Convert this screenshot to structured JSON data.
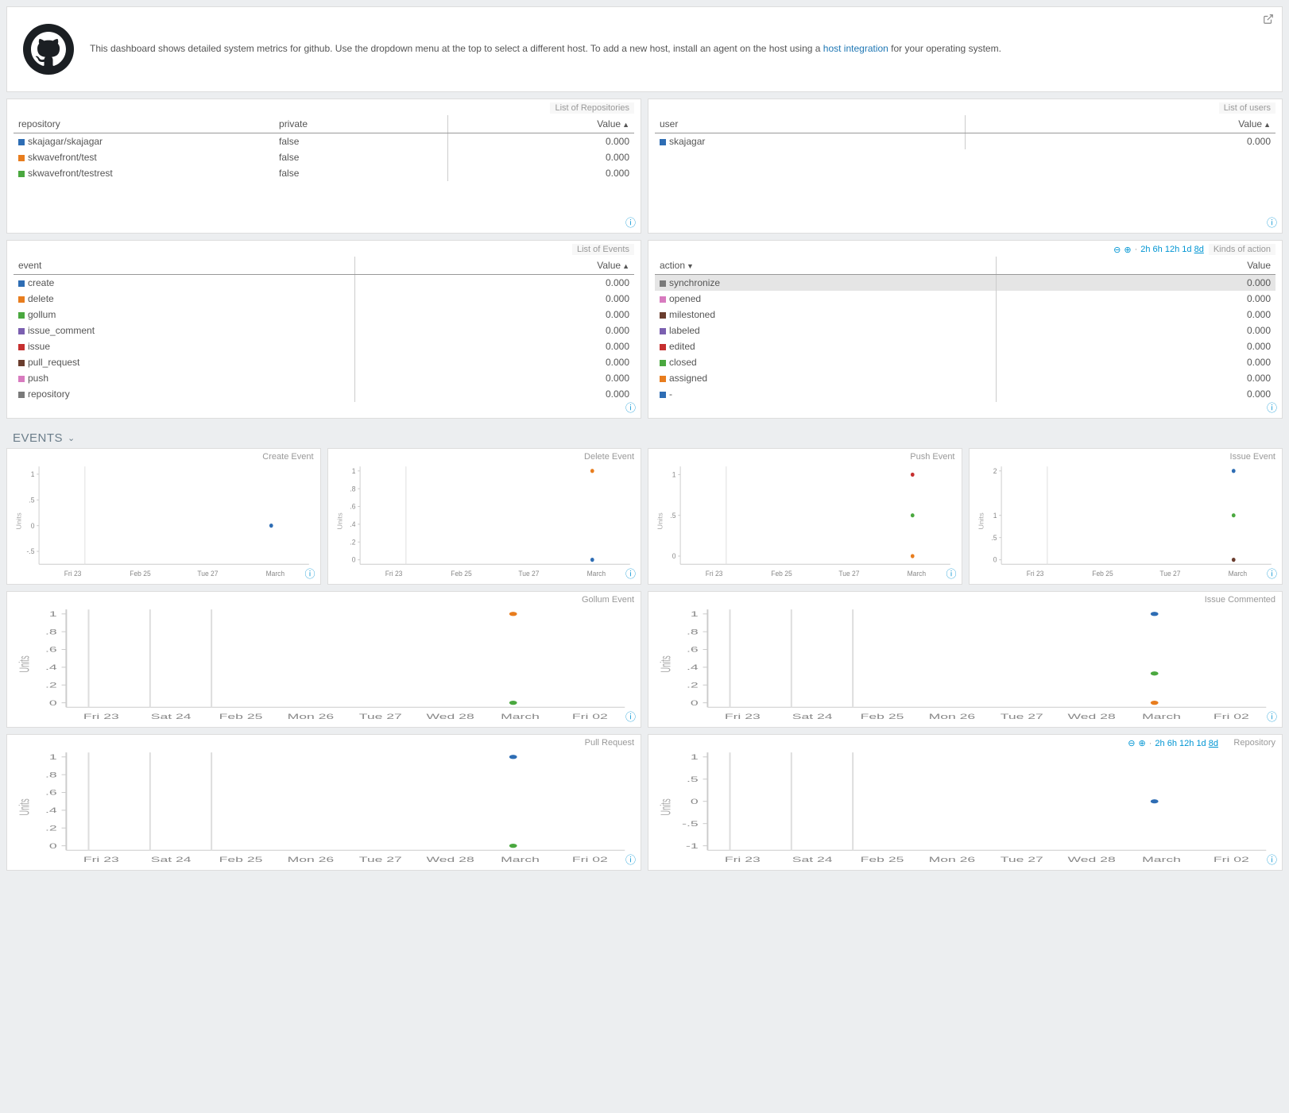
{
  "header": {
    "text_before": "This dashboard shows detailed system metrics for github. Use the dropdown menu at the top to select a different host. To add a new host, install an agent on the host using a ",
    "link_text": "host integration",
    "text_after": " for your operating system."
  },
  "time_links": [
    "2h",
    "6h",
    "12h",
    "1d",
    "8d"
  ],
  "panels": {
    "repos": {
      "title": "List of Repositories",
      "cols": [
        "repository",
        "private",
        "Value"
      ],
      "rows": [
        {
          "color": "#2e6db4",
          "name": "skajagar/skajagar",
          "private": "false",
          "value": "0.000"
        },
        {
          "color": "#e87d1e",
          "name": "skwavefront/test",
          "private": "false",
          "value": "0.000"
        },
        {
          "color": "#4aa83f",
          "name": "skwavefront/testrest",
          "private": "false",
          "value": "0.000"
        }
      ]
    },
    "users": {
      "title": "List of users",
      "cols": [
        "user",
        "Value"
      ],
      "rows": [
        {
          "color": "#2e6db4",
          "name": "skajagar",
          "value": "0.000"
        }
      ]
    },
    "events": {
      "title": "List of Events",
      "cols": [
        "event",
        "Value"
      ],
      "rows": [
        {
          "color": "#2e6db4",
          "name": "create",
          "value": "0.000"
        },
        {
          "color": "#e87d1e",
          "name": "delete",
          "value": "0.000"
        },
        {
          "color": "#4aa83f",
          "name": "gollum",
          "value": "0.000"
        },
        {
          "color": "#7b5fb0",
          "name": "issue_comment",
          "value": "0.000"
        },
        {
          "color": "#c62f2f",
          "name": "issue",
          "value": "0.000"
        },
        {
          "color": "#6a3d2e",
          "name": "pull_request",
          "value": "0.000"
        },
        {
          "color": "#d87bbf",
          "name": "push",
          "value": "0.000"
        },
        {
          "color": "#7a7a7a",
          "name": "repository",
          "value": "0.000"
        }
      ]
    },
    "actions": {
      "title": "Kinds of action",
      "cols": [
        "action",
        "Value"
      ],
      "rows": [
        {
          "color": "#7a7a7a",
          "name": "synchronize",
          "value": "0.000",
          "hl": true
        },
        {
          "color": "#d87bbf",
          "name": "opened",
          "value": "0.000"
        },
        {
          "color": "#6a3d2e",
          "name": "milestoned",
          "value": "0.000"
        },
        {
          "color": "#7b5fb0",
          "name": "labeled",
          "value": "0.000"
        },
        {
          "color": "#c62f2f",
          "name": "edited",
          "value": "0.000"
        },
        {
          "color": "#4aa83f",
          "name": "closed",
          "value": "0.000"
        },
        {
          "color": "#e87d1e",
          "name": "assigned",
          "value": "0.000"
        },
        {
          "color": "#2e6db4",
          "name": "-",
          "value": "0.000"
        }
      ]
    }
  },
  "section_title": "EVENTS",
  "chart_data": [
    {
      "title": "Create Event",
      "y_ticks": [
        "-.5",
        "0",
        ".5",
        "1"
      ],
      "x_ticks": [
        "Fri 23",
        "Feb 25",
        "Tue 27",
        "March"
      ],
      "y_range": [
        -0.75,
        1.15
      ],
      "vlines_x": [
        0.17
      ],
      "points": [
        {
          "x": 0.86,
          "y": 0,
          "color": "#2e6db4"
        }
      ]
    },
    {
      "title": "Delete Event",
      "y_ticks": [
        "0",
        ".2",
        ".4",
        ".6",
        ".8",
        "1"
      ],
      "x_ticks": [
        "Fri 23",
        "Feb 25",
        "Tue 27",
        "March"
      ],
      "y_range": [
        -0.05,
        1.05
      ],
      "vlines_x": [
        0.17
      ],
      "points": [
        {
          "x": 0.86,
          "y": 0,
          "color": "#2e6db4"
        },
        {
          "x": 0.86,
          "y": 1,
          "color": "#e87d1e"
        }
      ]
    },
    {
      "title": "Push Event",
      "y_ticks": [
        "0",
        ".5",
        "1"
      ],
      "x_ticks": [
        "Fri 23",
        "Feb 25",
        "Tue 27",
        "March"
      ],
      "y_range": [
        -0.1,
        1.1
      ],
      "vlines_x": [
        0.17
      ],
      "points": [
        {
          "x": 0.86,
          "y": 0,
          "color": "#e87d1e"
        },
        {
          "x": 0.86,
          "y": 0.5,
          "color": "#4aa83f"
        },
        {
          "x": 0.86,
          "y": 1,
          "color": "#c62f2f"
        }
      ]
    },
    {
      "title": "Issue Event",
      "y_ticks": [
        "0",
        ".5",
        "1",
        "2"
      ],
      "x_ticks": [
        "Fri 23",
        "Feb 25",
        "Tue 27",
        "March"
      ],
      "y_range": [
        -0.1,
        2.1
      ],
      "vlines_x": [
        0.17
      ],
      "points": [
        {
          "x": 0.86,
          "y": 0,
          "color": "#6a3d2e"
        },
        {
          "x": 0.86,
          "y": 1,
          "color": "#4aa83f"
        },
        {
          "x": 0.86,
          "y": 2,
          "color": "#2e6db4"
        }
      ]
    },
    {
      "title": "Gollum Event",
      "y_ticks": [
        "0",
        ".2",
        ".4",
        ".6",
        ".8",
        "1"
      ],
      "x_ticks": [
        "Fri 23",
        "Sat 24",
        "Feb 25",
        "Mon 26",
        "Tue 27",
        "Wed 28",
        "March",
        "Fri 02"
      ],
      "y_range": [
        -0.05,
        1.05
      ],
      "vlines_x": [
        0.04,
        0.15,
        0.26
      ],
      "points": [
        {
          "x": 0.8,
          "y": 0,
          "color": "#4aa83f"
        },
        {
          "x": 0.8,
          "y": 1,
          "color": "#e87d1e"
        }
      ]
    },
    {
      "title": "Issue Commented",
      "y_ticks": [
        "0",
        ".2",
        ".4",
        ".6",
        ".8",
        "1"
      ],
      "x_ticks": [
        "Fri 23",
        "Sat 24",
        "Feb 25",
        "Mon 26",
        "Tue 27",
        "Wed 28",
        "March",
        "Fri 02"
      ],
      "y_range": [
        -0.05,
        1.05
      ],
      "vlines_x": [
        0.04,
        0.15,
        0.26
      ],
      "points": [
        {
          "x": 0.8,
          "y": 0,
          "color": "#e87d1e"
        },
        {
          "x": 0.8,
          "y": 0.33,
          "color": "#4aa83f"
        },
        {
          "x": 0.8,
          "y": 1,
          "color": "#2e6db4"
        }
      ]
    },
    {
      "title": "Pull Request",
      "y_ticks": [
        "0",
        ".2",
        ".4",
        ".6",
        ".8",
        "1"
      ],
      "x_ticks": [
        "Fri 23",
        "Sat 24",
        "Feb 25",
        "Mon 26",
        "Tue 27",
        "Wed 28",
        "March",
        "Fri 02"
      ],
      "y_range": [
        -0.05,
        1.05
      ],
      "vlines_x": [
        0.04,
        0.15,
        0.26
      ],
      "points": [
        {
          "x": 0.8,
          "y": 0,
          "color": "#4aa83f"
        },
        {
          "x": 0.8,
          "y": 1,
          "color": "#2e6db4"
        }
      ]
    },
    {
      "title": "Repository",
      "y_ticks": [
        "-1",
        "-.5",
        "0",
        ".5",
        "1"
      ],
      "x_ticks": [
        "Fri 23",
        "Sat 24",
        "Feb 25",
        "Mon 26",
        "Tue 27",
        "Wed 28",
        "March",
        "Fri 02"
      ],
      "y_range": [
        -1.1,
        1.1
      ],
      "vlines_x": [
        0.04,
        0.15,
        0.26
      ],
      "show_time_links": true,
      "points": [
        {
          "x": 0.8,
          "y": 0,
          "color": "#2e6db4"
        }
      ]
    }
  ]
}
